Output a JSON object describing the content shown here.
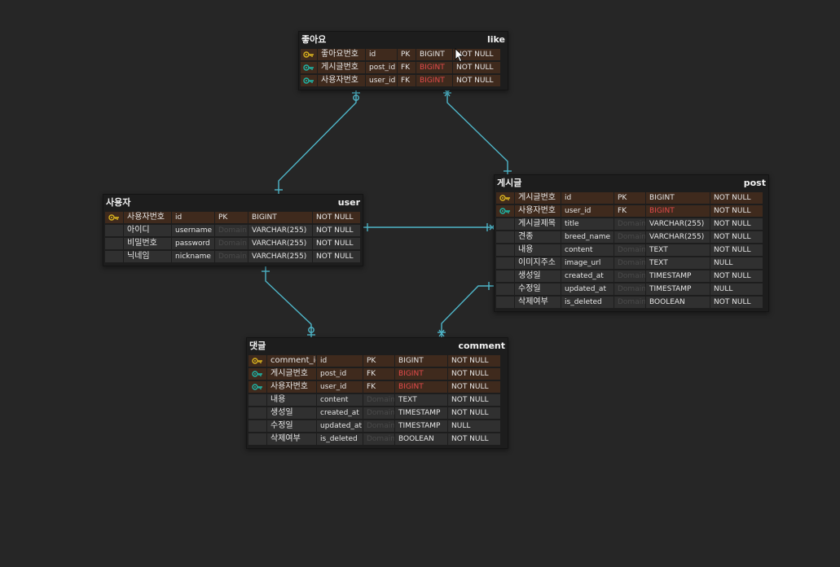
{
  "colors": {
    "background": "#262626",
    "connector": "#4fb6c9",
    "pk_icon": "#d9b21f",
    "fk_icon": "#1fb5a6",
    "fk_type_text": "#e34b4b",
    "key_row": "#3f2a1d"
  },
  "entities": {
    "like": {
      "title": "좋아요",
      "name": "like",
      "rows": [
        {
          "icon": "pk-key-icon",
          "key": true,
          "logical": "좋아요번호",
          "physical": "id",
          "keytype": "PK",
          "type": "BIGINT",
          "null": "NOT NULL"
        },
        {
          "icon": "fk-key-icon",
          "key": true,
          "logical": "게시글번호",
          "physical": "post_id",
          "keytype": "FK",
          "type": "BIGINT",
          "type_fk": true,
          "null": "NOT NULL"
        },
        {
          "icon": "fk-key-icon",
          "key": true,
          "logical": "사용자번호",
          "physical": "user_id",
          "keytype": "FK",
          "type": "BIGINT",
          "type_fk": true,
          "null": "NOT NULL"
        }
      ]
    },
    "user": {
      "title": "사용자",
      "name": "user",
      "rows": [
        {
          "icon": "pk-key-icon",
          "key": true,
          "logical": "사용자번호",
          "physical": "id",
          "keytype": "PK",
          "type": "BIGINT",
          "null": "NOT NULL"
        },
        {
          "icon": "",
          "key": false,
          "logical": "아이디",
          "physical": "username",
          "keytype": "Domain",
          "type": "VARCHAR(255)",
          "null": "NOT NULL"
        },
        {
          "icon": "",
          "key": false,
          "logical": "비밀번호",
          "physical": "password",
          "keytype": "Domain",
          "type": "VARCHAR(255)",
          "null": "NOT NULL"
        },
        {
          "icon": "",
          "key": false,
          "logical": "닉네임",
          "physical": "nickname",
          "keytype": "Domain",
          "type": "VARCHAR(255)",
          "null": "NOT NULL"
        }
      ]
    },
    "post": {
      "title": "게시글",
      "name": "post",
      "rows": [
        {
          "icon": "pk-key-icon",
          "key": true,
          "logical": "게시글번호",
          "physical": "id",
          "keytype": "PK",
          "type": "BIGINT",
          "null": "NOT NULL"
        },
        {
          "icon": "fk-key-icon",
          "key": true,
          "logical": "사용자번호",
          "physical": "user_id",
          "keytype": "FK",
          "type": "BIGINT",
          "type_fk": true,
          "null": "NOT NULL"
        },
        {
          "icon": "",
          "key": false,
          "logical": "게시글제목",
          "physical": "title",
          "keytype": "Domain",
          "type": "VARCHAR(255)",
          "null": "NOT NULL"
        },
        {
          "icon": "",
          "key": false,
          "logical": "견종",
          "physical": "breed_name",
          "keytype": "Domain",
          "type": "VARCHAR(255)",
          "null": "NOT NULL"
        },
        {
          "icon": "",
          "key": false,
          "logical": "내용",
          "physical": "content",
          "keytype": "Domain",
          "type": "TEXT",
          "null": "NOT NULL"
        },
        {
          "icon": "",
          "key": false,
          "logical": "이미지주소",
          "physical": "image_url",
          "keytype": "Domain",
          "type": "TEXT",
          "null": "NULL"
        },
        {
          "icon": "",
          "key": false,
          "logical": "생성일",
          "physical": "created_at",
          "keytype": "Domain",
          "type": "TIMESTAMP",
          "null": "NOT NULL"
        },
        {
          "icon": "",
          "key": false,
          "logical": "수정일",
          "physical": "updated_at",
          "keytype": "Domain",
          "type": "TIMESTAMP",
          "null": "NULL"
        },
        {
          "icon": "",
          "key": false,
          "logical": "삭제여부",
          "physical": "is_deleted",
          "keytype": "Domain",
          "type": "BOOLEAN",
          "null": "NOT NULL"
        }
      ]
    },
    "comment": {
      "title": "댓글",
      "name": "comment",
      "rows": [
        {
          "icon": "pk-key-icon",
          "key": true,
          "logical": "comment_id",
          "physical": "id",
          "keytype": "PK",
          "type": "BIGINT",
          "null": "NOT NULL"
        },
        {
          "icon": "fk-key-icon",
          "key": true,
          "logical": "게시글번호",
          "physical": "post_id",
          "keytype": "FK",
          "type": "BIGINT",
          "type_fk": true,
          "null": "NOT NULL"
        },
        {
          "icon": "fk-key-icon",
          "key": true,
          "logical": "사용자번호",
          "physical": "user_id",
          "keytype": "FK",
          "type": "BIGINT",
          "type_fk": true,
          "null": "NOT NULL"
        },
        {
          "icon": "",
          "key": false,
          "logical": "내용",
          "physical": "content",
          "keytype": "Domain",
          "type": "TEXT",
          "null": "NOT NULL"
        },
        {
          "icon": "",
          "key": false,
          "logical": "생성일",
          "physical": "created_at",
          "keytype": "Domain",
          "type": "TIMESTAMP",
          "null": "NOT NULL"
        },
        {
          "icon": "",
          "key": false,
          "logical": "수정일",
          "physical": "updated_at",
          "keytype": "Domain",
          "type": "TIMESTAMP",
          "null": "NULL"
        },
        {
          "icon": "",
          "key": false,
          "logical": "삭제여부",
          "physical": "is_deleted",
          "keytype": "Domain",
          "type": "BOOLEAN",
          "null": "NOT NULL"
        }
      ]
    }
  },
  "relationships": [
    {
      "from": "user",
      "to": "like",
      "label": "user-to-like"
    },
    {
      "from": "post",
      "to": "like",
      "label": "post-to-like"
    },
    {
      "from": "user",
      "to": "post",
      "label": "user-to-post"
    },
    {
      "from": "user",
      "to": "comment",
      "label": "user-to-comment"
    },
    {
      "from": "post",
      "to": "comment",
      "label": "post-to-comment"
    }
  ]
}
